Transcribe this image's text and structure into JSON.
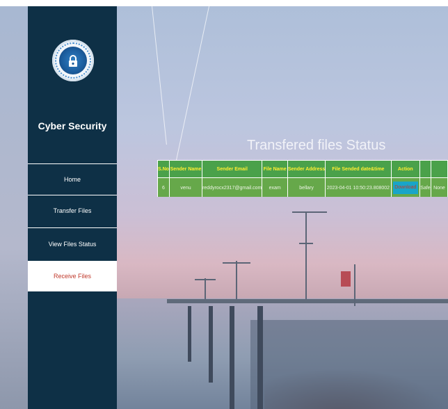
{
  "sidebar": {
    "brand": "Cyber Security",
    "items": [
      {
        "label": "Home",
        "active": false
      },
      {
        "label": "Transfer Files",
        "active": false
      },
      {
        "label": "View Files Status",
        "active": false
      },
      {
        "label": "Receive Files",
        "active": true
      }
    ]
  },
  "main": {
    "title": "Transfered files Status",
    "table": {
      "headers": [
        "S.No",
        "Sender Name",
        "Sender Email",
        "File Name",
        "Sender Address",
        "File Sended date&time",
        "Action",
        "",
        ""
      ],
      "rows": [
        [
          "6",
          "venu",
          "reddyrocx2317@gmail.com",
          "exam",
          "bellary",
          "2023-04-01 10:50:23.808002",
          "Download",
          "Safe",
          "None"
        ]
      ]
    }
  },
  "colors": {
    "sidebar_bg": "#0e3046",
    "table_header_bg": "#4aa14a",
    "table_header_text": "#ffee33",
    "table_cell_bg": "#66a84a",
    "download_bg": "#19a5c8",
    "download_text": "#c0392b",
    "active_nav_text": "#c0392b"
  }
}
